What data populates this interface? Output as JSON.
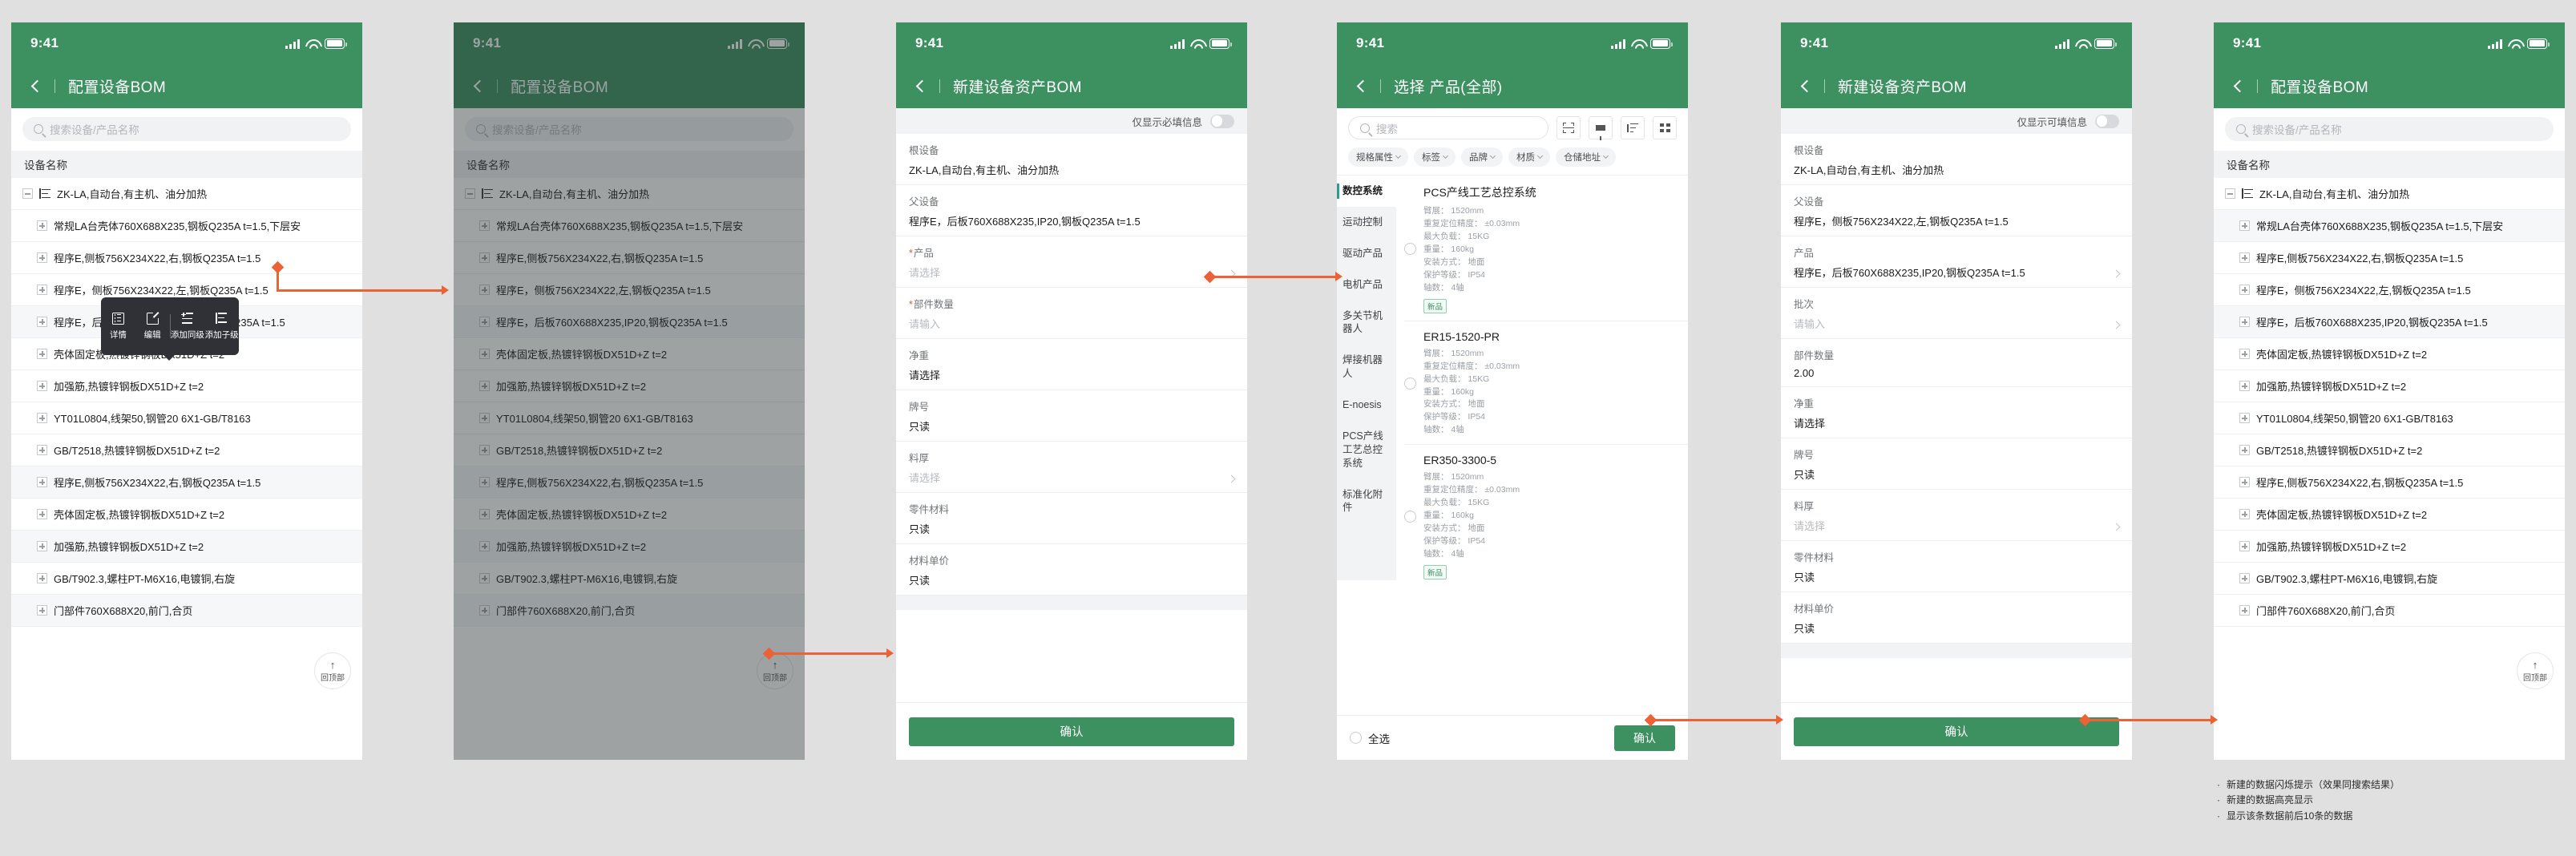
{
  "status_bar": {
    "time": "9:41"
  },
  "panels": {
    "bom_list": {
      "nav_title": "配置设备BOM",
      "search_placeholder": "搜索设备/产品名称",
      "list_header": "设备名称",
      "fab_label": "回顶部",
      "fab_icon": "arrow-up-icon",
      "rows": [
        {
          "toggle": "minus",
          "has_tree_icon": true,
          "label": "ZK-LA,自动台,有主机、油分加热"
        },
        {
          "toggle": "plus",
          "has_tree_icon": false,
          "label": "常规LA台壳体760X688X235,钢板Q235A t=1.5,下层安"
        },
        {
          "toggle": "plus",
          "has_tree_icon": false,
          "label": "程序E,侧板756X234X22,右,钢板Q235A t=1.5"
        },
        {
          "toggle": "plus",
          "has_tree_icon": false,
          "label": "程序E，侧板756X234X22,左,钢板Q235A t=1.5"
        },
        {
          "toggle": "plus",
          "has_tree_icon": false,
          "label": "程序E，后板760X688X235,IP20,钢板Q235A t=1.5"
        },
        {
          "toggle": "plus",
          "has_tree_icon": false,
          "label": "壳体固定板,热镀锌钢板DX51D+Z t=2"
        },
        {
          "toggle": "plus",
          "has_tree_icon": false,
          "label": "加强筋,热镀锌钢板DX51D+Z t=2"
        },
        {
          "toggle": "plus",
          "has_tree_icon": false,
          "label": "YT01L0804,线架50,钢管20 6X1-GB/T8163"
        },
        {
          "toggle": "plus",
          "has_tree_icon": false,
          "label": "GB/T2518,热镀锌钢板DX51D+Z t=2"
        },
        {
          "toggle": "plus",
          "has_tree_icon": false,
          "label": "程序E,侧板756X234X22,右,钢板Q235A t=1.5"
        },
        {
          "toggle": "plus",
          "has_tree_icon": false,
          "label": "壳体固定板,热镀锌钢板DX51D+Z t=2"
        },
        {
          "toggle": "plus",
          "has_tree_icon": false,
          "label": "加强筋,热镀锌钢板DX51D+Z t=2"
        },
        {
          "toggle": "plus",
          "has_tree_icon": false,
          "label": "GB/T902.3,螺柱PT-M6X16,电镀铜,右旋"
        },
        {
          "toggle": "plus",
          "has_tree_icon": false,
          "label": "门部件760X688X20,前门,合页"
        }
      ],
      "context_menu": {
        "items": [
          {
            "icon": "list-detail-icon",
            "label": "详情"
          },
          {
            "icon": "edit-pencil-icon",
            "label": "编辑"
          },
          {
            "icon": "add-sibling-icon",
            "label": "添加同级"
          },
          {
            "icon": "add-child-icon",
            "label": "添加子级"
          }
        ]
      }
    },
    "new_bom_empty": {
      "nav_title": "新建设备资产BOM",
      "toggle_label": "仅显示必填信息",
      "fields": [
        {
          "label": "根设备",
          "required": false,
          "value": "ZK-LA,自动台,有主机、油分加热",
          "placeholder_style": false,
          "chevron": false
        },
        {
          "label": "父设备",
          "required": false,
          "value": "程序E，后板760X688X235,IP20,钢板Q235A t=1.5",
          "placeholder_style": false,
          "chevron": false
        },
        {
          "label": "产品",
          "required": true,
          "value": "请选择",
          "placeholder_style": true,
          "chevron": true
        },
        {
          "label": "部件数量",
          "required": true,
          "value": "请输入",
          "placeholder_style": true,
          "chevron": false
        },
        {
          "label": "净重",
          "required": false,
          "value": "请选择",
          "placeholder_style": false,
          "chevron": false
        },
        {
          "label": "牌号",
          "required": false,
          "value": "只读",
          "placeholder_style": false,
          "chevron": false
        },
        {
          "label": "料厚",
          "required": false,
          "value": "请选择",
          "placeholder_style": true,
          "chevron": true
        },
        {
          "label": "零件材料",
          "required": false,
          "value": "只读",
          "placeholder_style": false,
          "chevron": false
        },
        {
          "label": "材料单价",
          "required": false,
          "value": "只读",
          "placeholder_style": false,
          "chevron": false
        }
      ],
      "confirm_label": "确认"
    },
    "select_product": {
      "nav_title": "选择 产品(全部)",
      "search_placeholder": "搜索",
      "tool_icons": [
        "scan-icon",
        "filter-icon",
        "sort-icon",
        "grid-view-icon"
      ],
      "chips": [
        "规格属性",
        "标签",
        "品牌",
        "材质",
        "仓储地址"
      ],
      "categories": [
        {
          "label": "数控系统",
          "active": true
        },
        {
          "label": "运动控制",
          "active": false
        },
        {
          "label": "驱动产品",
          "active": false
        },
        {
          "label": "电机产品",
          "active": false
        },
        {
          "label": "多关节机器人",
          "active": false
        },
        {
          "label": "焊接机器人",
          "active": false
        },
        {
          "label": "E-noesis",
          "active": false
        },
        {
          "label": "PCS产线工艺总控系统",
          "active": false
        },
        {
          "label": "标准化附件",
          "active": false
        }
      ],
      "products": [
        {
          "name": "PCS产线工艺总控系统",
          "badge": "新品",
          "specs": [
            "臂展： 1520mm",
            "重复定位精度： ±0.03mm",
            "最大负载： 15KG",
            "重量： 160kg",
            "安装方式： 地面",
            "保护等级： IP54",
            "轴数： 4轴"
          ]
        },
        {
          "name": "ER15-1520-PR",
          "badge": "",
          "specs": [
            "臂展： 1520mm",
            "重复定位精度： ±0.03mm",
            "最大负载： 15KG",
            "重量： 160kg",
            "安装方式： 地面",
            "保护等级： IP54",
            "轴数： 4轴"
          ]
        },
        {
          "name": "ER350-3300-5",
          "badge": "新品",
          "specs": [
            "臂展： 1520mm",
            "重复定位精度： ±0.03mm",
            "最大负载： 15KG",
            "重量： 160kg",
            "安装方式： 地面",
            "保护等级： IP54",
            "轴数： 4轴"
          ]
        }
      ],
      "select_all_label": "全选",
      "confirm_label": "确认"
    },
    "new_bom_filled": {
      "nav_title": "新建设备资产BOM",
      "toggle_label": "仅显示可填信息",
      "fields": [
        {
          "label": "根设备",
          "required": false,
          "value": "ZK-LA,自动台,有主机、油分加热",
          "placeholder_style": false,
          "chevron": false
        },
        {
          "label": "父设备",
          "required": false,
          "value": "程序E，侧板756X234X22,左,钢板Q235A t=1.5",
          "placeholder_style": false,
          "chevron": false
        },
        {
          "label": "产品",
          "required": false,
          "value": "程序E，后板760X688X235,IP20,钢板Q235A t=1.5",
          "placeholder_style": false,
          "chevron": true
        },
        {
          "label": "批次",
          "required": false,
          "value": "请输入",
          "placeholder_style": true,
          "chevron": true
        },
        {
          "label": "部件数量",
          "required": false,
          "value": "2.00",
          "placeholder_style": false,
          "chevron": false
        },
        {
          "label": "净重",
          "required": false,
          "value": "请选择",
          "placeholder_style": false,
          "chevron": false
        },
        {
          "label": "牌号",
          "required": false,
          "value": "只读",
          "placeholder_style": false,
          "chevron": false
        },
        {
          "label": "料厚",
          "required": false,
          "value": "请选择",
          "placeholder_style": true,
          "chevron": true
        },
        {
          "label": "零件材料",
          "required": false,
          "value": "只读",
          "placeholder_style": false,
          "chevron": false
        },
        {
          "label": "材料单价",
          "required": false,
          "value": "只读",
          "placeholder_style": false,
          "chevron": false
        }
      ],
      "confirm_label": "确认"
    },
    "bom_list_result": {
      "nav_title": "配置设备BOM",
      "search_placeholder": "搜索设备/产品名称",
      "list_header": "设备名称",
      "fab_label": "回顶部",
      "rows": [
        {
          "toggle": "minus",
          "has_tree_icon": true,
          "label": "ZK-LA,自动台,有主机、油分加热",
          "highlight": false
        },
        {
          "toggle": "plus",
          "has_tree_icon": false,
          "label": "常规LA台壳体760X688X235,钢板Q235A t=1.5,下层安",
          "highlight": true
        },
        {
          "toggle": "plus",
          "has_tree_icon": false,
          "label": "程序E,侧板756X234X22,右,钢板Q235A t=1.5",
          "highlight": false
        },
        {
          "toggle": "plus",
          "has_tree_icon": false,
          "label": "程序E，侧板756X234X22,左,钢板Q235A t=1.5",
          "highlight": false
        },
        {
          "toggle": "plus",
          "has_tree_icon": false,
          "label": "程序E，后板760X688X235,IP20,钢板Q235A t=1.5",
          "highlight": true
        },
        {
          "toggle": "plus",
          "has_tree_icon": false,
          "label": "壳体固定板,热镀锌钢板DX51D+Z t=2",
          "highlight": false
        },
        {
          "toggle": "plus",
          "has_tree_icon": false,
          "label": "加强筋,热镀锌钢板DX51D+Z t=2",
          "highlight": false
        },
        {
          "toggle": "plus",
          "has_tree_icon": false,
          "label": "YT01L0804,线架50,钢管20 6X1-GB/T8163",
          "highlight": false
        },
        {
          "toggle": "plus",
          "has_tree_icon": false,
          "label": "GB/T2518,热镀锌钢板DX51D+Z t=2",
          "highlight": false
        },
        {
          "toggle": "plus",
          "has_tree_icon": false,
          "label": "程序E,侧板756X234X22,右,钢板Q235A t=1.5",
          "highlight": false
        },
        {
          "toggle": "plus",
          "has_tree_icon": false,
          "label": "壳体固定板,热镀锌钢板DX51D+Z t=2",
          "highlight": false
        },
        {
          "toggle": "plus",
          "has_tree_icon": false,
          "label": "加强筋,热镀锌钢板DX51D+Z t=2",
          "highlight": false
        },
        {
          "toggle": "plus",
          "has_tree_icon": false,
          "label": "GB/T902.3,螺柱PT-M6X16,电镀铜,右旋",
          "highlight": false
        },
        {
          "toggle": "plus",
          "has_tree_icon": false,
          "label": "门部件760X688X20,前门,合页",
          "highlight": false
        }
      ]
    }
  },
  "notes": [
    "新建的数据闪烁提示（效果同搜索结果）",
    "新建的数据高亮显示",
    "显示该条数据前后10条的数据"
  ],
  "colors": {
    "brand_green": "#3d9161",
    "accent_orange": "#ec6136",
    "menu_dark": "#2f3136",
    "page_bg": "#e0e0e0"
  }
}
